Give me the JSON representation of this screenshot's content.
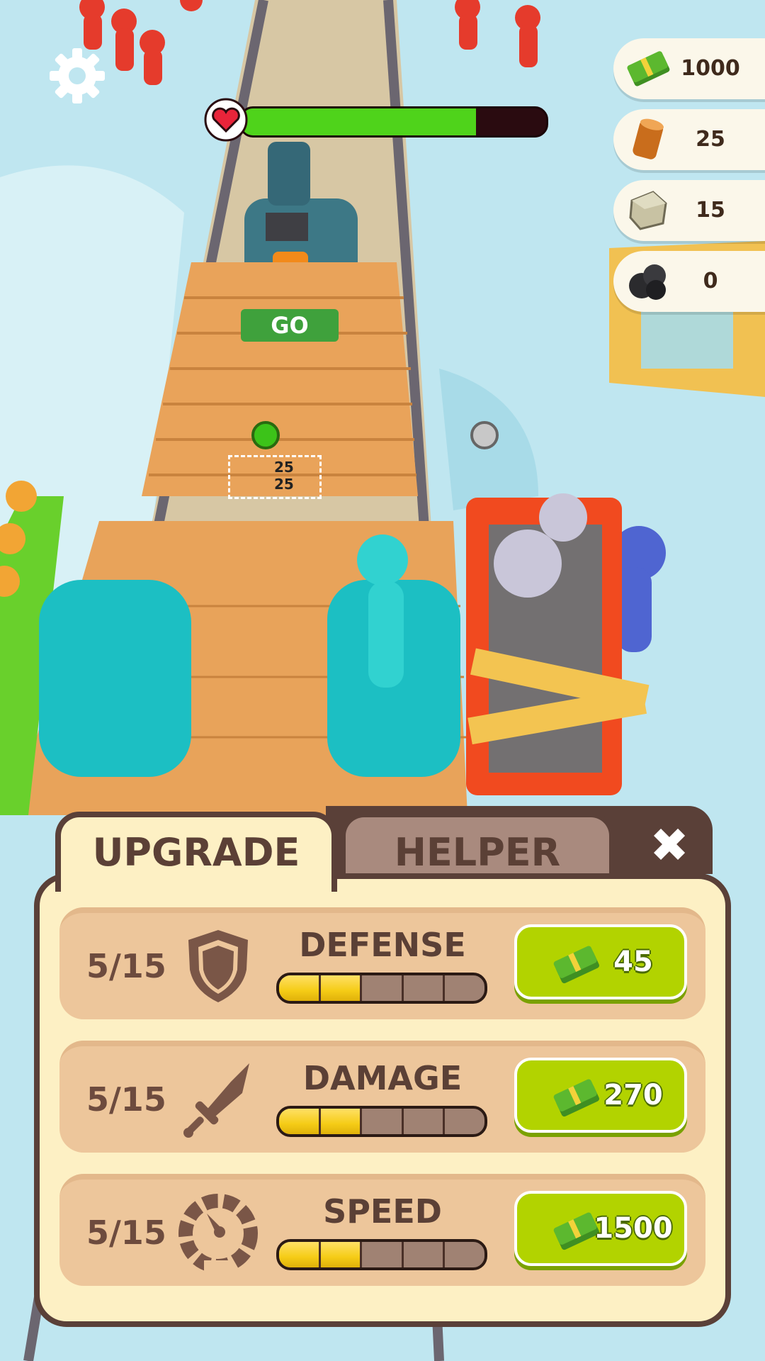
{
  "hud": {
    "health_fraction": 0.77,
    "resources": [
      {
        "icon": "cash-icon",
        "value": "1000"
      },
      {
        "icon": "wood-log-icon",
        "value": "25"
      },
      {
        "icon": "stone-block-icon",
        "value": "15"
      },
      {
        "icon": "coal-icon",
        "value": "0"
      }
    ]
  },
  "world": {
    "go_label": "GO",
    "cargo": [
      "25",
      "25"
    ]
  },
  "panel": {
    "tabs": {
      "upgrade": "UPGRADE",
      "helper": "HELPER"
    },
    "close_symbol": "✖",
    "rows": [
      {
        "level": "5/15",
        "icon": "shield-icon",
        "name": "DEFENSE",
        "filled": 2,
        "segments": 5,
        "price": "45"
      },
      {
        "level": "5/15",
        "icon": "sword-icon",
        "name": "DAMAGE",
        "filled": 2,
        "segments": 5,
        "price": "270"
      },
      {
        "level": "5/15",
        "icon": "speedometer-icon",
        "name": "SPEED",
        "filled": 2,
        "segments": 5,
        "price": "1500"
      }
    ]
  },
  "colors": {
    "panel_bg": "#fdf0c4",
    "panel_border": "#5a4038",
    "buy_button": "#b2d300",
    "health_fill": "#4fd31b"
  }
}
